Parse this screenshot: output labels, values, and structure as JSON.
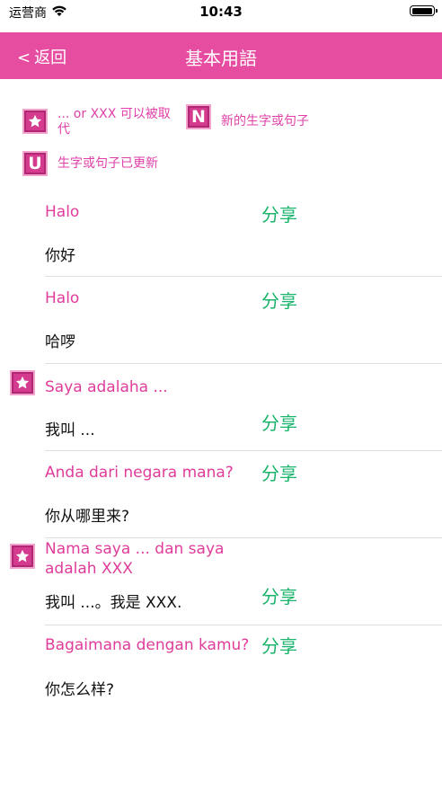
{
  "status": {
    "carrier": "运营商",
    "time": "10:43"
  },
  "nav": {
    "back_label": "返回",
    "title": "基本用語"
  },
  "legend": {
    "star_text": "... or XXX 可以被取代",
    "new_letter": "N",
    "new_text": "新的生字或句子",
    "updated_letter": "U",
    "updated_text": "生字或句子已更新"
  },
  "share_label": "分享",
  "phrases": [
    {
      "text": "Halo",
      "translation": "你好",
      "starred": false
    },
    {
      "text": "Halo",
      "translation": "哈啰",
      "starred": false
    },
    {
      "text": "Saya adalaha ...",
      "translation": "我叫 ...",
      "starred": true
    },
    {
      "text": "Anda dari negara mana?",
      "translation": "你从哪里来?",
      "starred": false
    },
    {
      "text": "Nama saya ... dan saya adalah XXX",
      "translation": "我叫 ...。我是 XXX.",
      "starred": true
    },
    {
      "text": "Bagaimana dengan kamu?",
      "translation": "你怎么样?",
      "starred": false
    }
  ],
  "colors": {
    "accent": "#e64ca0",
    "phrase": "#e03c9a",
    "share": "#19b36a"
  }
}
